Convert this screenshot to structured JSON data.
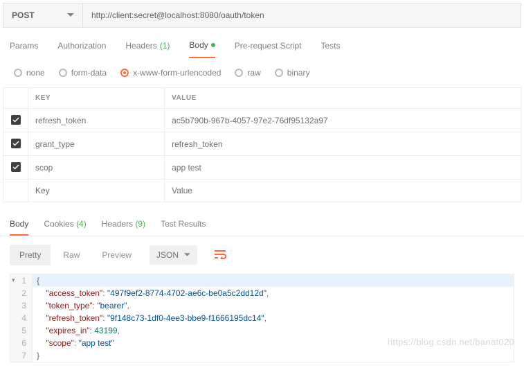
{
  "request": {
    "method": "POST",
    "url": "http://client:secret@localhost:8080/oauth/token"
  },
  "request_tabs": {
    "params": "Params",
    "auth": "Authorization",
    "headers": "Headers",
    "headers_count": "(1)",
    "body": "Body",
    "prerequest": "Pre-request Script",
    "tests": "Tests"
  },
  "body_types": {
    "none": "none",
    "form": "form-data",
    "urlenc": "x-www-form-urlencoded",
    "raw": "raw",
    "binary": "binary"
  },
  "kv": {
    "key_header": "KEY",
    "value_header": "VALUE",
    "rows": [
      {
        "key": "refresh_token",
        "value": "ac5b790b-967b-4057-97e2-76df95132a97"
      },
      {
        "key": "grant_type",
        "value": "refresh_token"
      },
      {
        "key": "scop",
        "value": "app test"
      }
    ],
    "key_placeholder": "Key",
    "value_placeholder": "Value"
  },
  "response_tabs": {
    "body": "Body",
    "cookies": "Cookies",
    "cookies_count": "(4)",
    "headers": "Headers",
    "headers_count": "(9)",
    "tests": "Test Results"
  },
  "toolbar": {
    "pretty": "Pretty",
    "raw": "Raw",
    "preview": "Preview",
    "format": "JSON"
  },
  "json": {
    "access_token_k": "\"access_token\"",
    "access_token_v": "\"497f9ef2-8774-4702-ae6c-be0a5c2dd12d\"",
    "token_type_k": "\"token_type\"",
    "token_type_v": "\"bearer\"",
    "refresh_token_k": "\"refresh_token\"",
    "refresh_token_v": "\"9f148c73-1df0-4ee3-bbe9-f1666195dc14\"",
    "expires_in_k": "\"expires_in\"",
    "expires_in_v": "43199",
    "scope_k": "\"scope\"",
    "scope_v": "\"app test\""
  },
  "watermark": "https://blog.csdn.net/banat020"
}
